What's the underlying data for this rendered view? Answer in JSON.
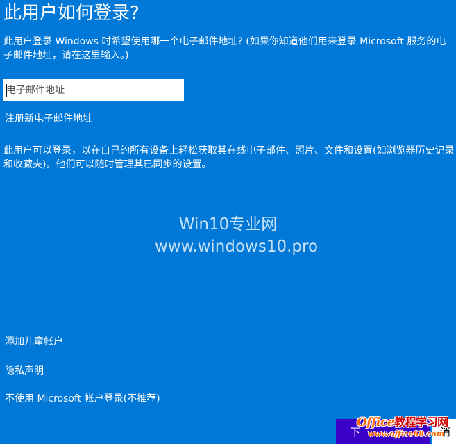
{
  "dialog": {
    "title": "此用户如何登录?",
    "description": "此用户登录 Windows 时希望使用哪一个电子邮件地址? (如果你知道他们用来登录 Microsoft 服务的电子邮件地址，请在这里输入。)",
    "email": {
      "value": "",
      "placeholder": "电子邮件地址"
    },
    "register_link": "注册新电子邮件地址",
    "info": "此用户可以登录，以在自己的所有设备上轻松获取其在线电子邮件、照片、文件和设置(如浏览器历史记录和收藏夹)。他们可以随时管理其已同步的设置。",
    "add_child_link": "添加儿童帐户",
    "privacy_link": "隐私声明",
    "no_microsoft_link": "不使用 Microsoft 帐户登录(不推荐)",
    "next_label": "下",
    "cancel_label": "消"
  },
  "watermark": {
    "line1": "Win10专业网",
    "line2": "www.windows10.pro"
  },
  "stamp": {
    "latin": "Office",
    "chinese": "教程学习网",
    "url": "www.office68.com"
  },
  "colors": {
    "background": "#0078d7",
    "primary_button": "#3a00c8",
    "stamp_orange": "#ff6a00",
    "stamp_red": "#d10000"
  }
}
